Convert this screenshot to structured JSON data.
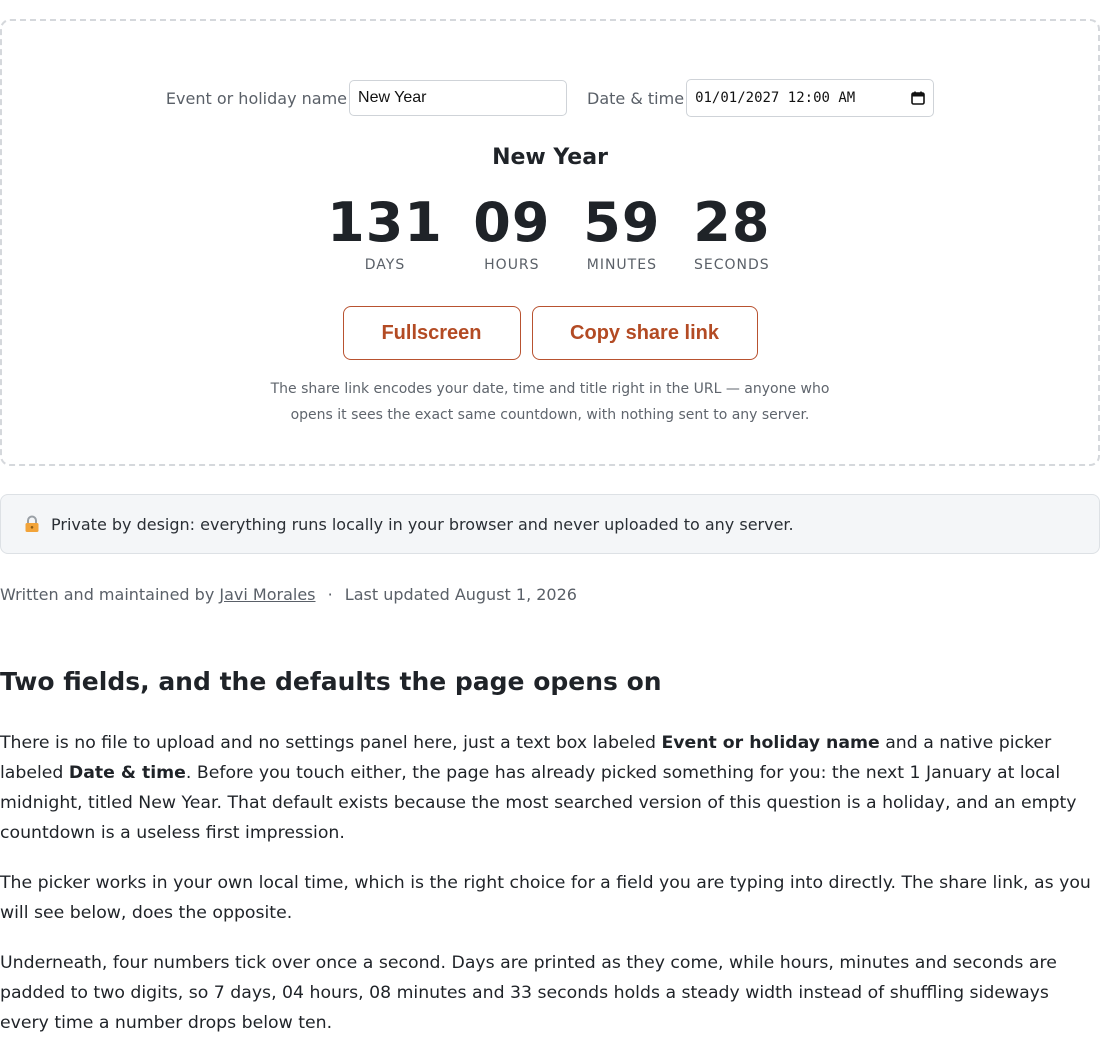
{
  "form": {
    "name_label": "Event or holiday name",
    "name_value": "New Year",
    "date_label": "Date & time",
    "date_value": "01/01/2027 12:00 AM",
    "date_icon": "calendar-icon"
  },
  "countdown": {
    "title": "New Year",
    "units": [
      {
        "value": "131",
        "label": "DAYS"
      },
      {
        "value": "09",
        "label": "HOURS"
      },
      {
        "value": "59",
        "label": "MINUTES"
      },
      {
        "value": "28",
        "label": "SECONDS"
      }
    ]
  },
  "buttons": {
    "fullscreen": "Fullscreen",
    "copy": "Copy share link"
  },
  "share_note": {
    "line1": "The share link encodes your date, time and title right in the URL — anyone who",
    "line2": "opens it sees the exact same countdown, with nothing sent to any server."
  },
  "privacy": {
    "icon": "lock-icon",
    "text": "Private by design: everything runs locally in your browser and never uploaded to any server."
  },
  "meta": {
    "prefix": "Written and maintained by",
    "author": "Javi Morales",
    "separator": "·",
    "updated": "Last updated August 1, 2026"
  },
  "article": {
    "heading": "Two fields, and the defaults the page opens on",
    "p1_a": "There is no file to upload and no settings panel here, just a text box labeled ",
    "p1_b": "Event or holiday name",
    "p1_c": " and a native picker labeled ",
    "p1_d": "Date & time",
    "p1_e": ". Before you touch either, the page has already picked something for you: the next 1 January at local midnight, titled New Year. That default exists because the most searched version of this question is a holiday, and an empty countdown is a useless first impression.",
    "p2": "The picker works in your own local time, which is the right choice for a field you are typing into directly. The share link, as you will see below, does the opposite.",
    "p3": "Underneath, four numbers tick over once a second. Days are printed as they come, while hours, minutes and seconds are padded to two digits, so 7 days, 04 hours, 08 minutes and 33 seconds holds a steady width instead of shuffling sideways every time a number drops below ten."
  },
  "colors": {
    "accent": "#b34b24",
    "text": "#1f2328",
    "muted": "#5a6068",
    "banner_bg": "#f4f6f8"
  }
}
